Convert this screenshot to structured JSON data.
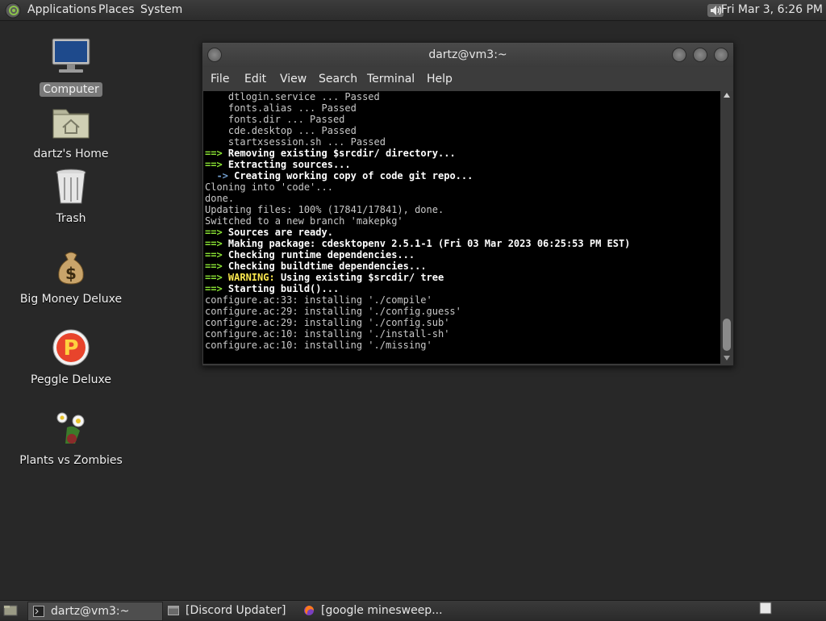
{
  "top_panel": {
    "menus": [
      "Applications",
      "Places",
      "System"
    ],
    "clock": "Fri Mar  3,  6:26 PM",
    "volume_icon": "volume-icon"
  },
  "desktop": {
    "icons": [
      {
        "label": "Computer",
        "icon": "computer-icon",
        "selected": true
      },
      {
        "label": "dartz's Home",
        "icon": "home-folder-icon"
      },
      {
        "label": "Trash",
        "icon": "trash-icon"
      },
      {
        "label": "Big Money Deluxe",
        "icon": "money-bag-icon"
      },
      {
        "label": "Peggle Deluxe",
        "icon": "peggle-icon"
      },
      {
        "label": "Plants vs Zombies",
        "icon": "plants-vs-zombies-icon"
      }
    ]
  },
  "terminal": {
    "title": "dartz@vm3:~",
    "menus": [
      "File",
      "Edit",
      "View",
      "Search",
      "Terminal",
      "Help"
    ],
    "lines": [
      {
        "pre": "    ",
        "text": "dtlogin.service ... Passed"
      },
      {
        "pre": "    ",
        "text": "fonts.alias ... Passed"
      },
      {
        "pre": "    ",
        "text": "fonts.dir ... Passed"
      },
      {
        "pre": "    ",
        "text": "cde.desktop ... Passed"
      },
      {
        "pre": "    ",
        "text": "startxsession.sh ... Passed"
      },
      {
        "arrow": "==>",
        "bold": " Removing existing $srcdir/ directory..."
      },
      {
        "arrow": "==>",
        "bold": " Extracting sources..."
      },
      {
        "pre": "  ",
        "sub": "->",
        "bold": " Creating working copy of code git repo..."
      },
      {
        "text": "Cloning into 'code'..."
      },
      {
        "text": "done."
      },
      {
        "text": "Updating files: 100% (17841/17841), done."
      },
      {
        "text": "Switched to a new branch 'makepkg'"
      },
      {
        "arrow": "==>",
        "bold": " Sources are ready."
      },
      {
        "arrow": "==>",
        "bold": " Making package: cdesktopenv 2.5.1-1 (Fri 03 Mar 2023 06:25:53 PM EST)"
      },
      {
        "arrow": "==>",
        "bold": " Checking runtime dependencies..."
      },
      {
        "arrow": "==>",
        "bold": " Checking buildtime dependencies..."
      },
      {
        "arrow": "==>",
        "warn": " WARNING:",
        "bold": " Using existing $srcdir/ tree"
      },
      {
        "arrow": "==>",
        "bold": " Starting build()..."
      },
      {
        "text": "configure.ac:33: installing './compile'"
      },
      {
        "text": "configure.ac:29: installing './config.guess'"
      },
      {
        "text": "configure.ac:29: installing './config.sub'"
      },
      {
        "text": "configure.ac:10: installing './install-sh'"
      },
      {
        "text": "configure.ac:10: installing './missing'"
      }
    ]
  },
  "taskbar": {
    "tasks": [
      {
        "label": "dartz@vm3:~",
        "icon": "terminal-icon",
        "active": true
      },
      {
        "label": "[Discord Updater]",
        "icon": "window-icon"
      },
      {
        "label": "[google minesweep...",
        "icon": "firefox-icon"
      }
    ],
    "show_desktop_icon": "show-desktop-icon",
    "workspace_icon": "workspace-icon"
  },
  "colors": {
    "desktop_bg": "#282828",
    "terminal_bg": "#000000",
    "arrow": "#8ae234",
    "warning": "#fce94f",
    "sub_arrow": "#729fcf"
  }
}
